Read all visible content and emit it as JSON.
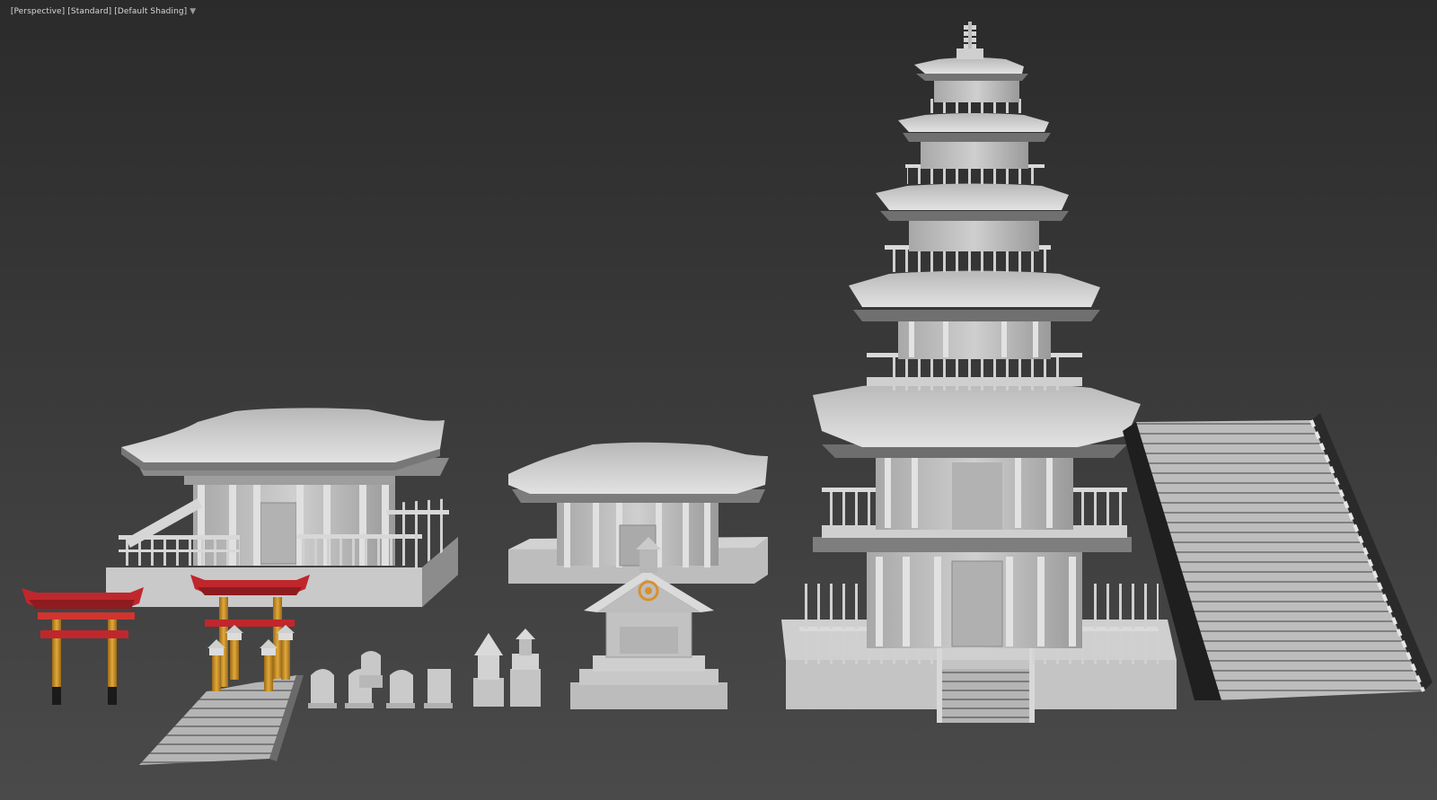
{
  "viewport": {
    "labels": {
      "view": "[Perspective]",
      "renderer": "[Standard]",
      "shading": "[Default Shading]"
    },
    "filter_icon": "funnel-icon",
    "background": "#2e2e2e"
  },
  "scene": {
    "objects": [
      {
        "name": "temple-hall-left",
        "kind": "temple-hall"
      },
      {
        "name": "temple-hall-small",
        "kind": "temple-hall"
      },
      {
        "name": "pagoda",
        "kind": "five-story-pagoda"
      },
      {
        "name": "stairway",
        "kind": "stairs"
      },
      {
        "name": "torii-gate-1",
        "kind": "torii"
      },
      {
        "name": "torii-gate-2",
        "kind": "torii"
      },
      {
        "name": "stone-lanterns",
        "kind": "lantern"
      },
      {
        "name": "gravestones",
        "kind": "gravestone"
      },
      {
        "name": "small-shrine",
        "kind": "shrine"
      }
    ],
    "colors": {
      "clay": "#c8c8c8",
      "clay_shadow": "#8a8a8a",
      "torii_red": "#c0272d",
      "torii_pillar": "#d49a2e",
      "dark": "#1a1a1a"
    }
  }
}
